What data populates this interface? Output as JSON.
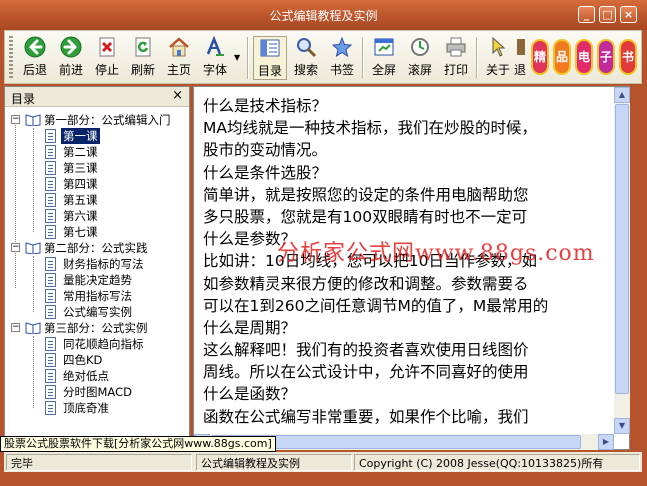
{
  "window": {
    "title": "公式编辑教程及实例",
    "controls": {
      "minimize": "_",
      "maximize": "□",
      "close": "×"
    }
  },
  "toolbar": {
    "buttons": [
      {
        "id": "back",
        "label": "后退",
        "icon": "back-arrow-icon"
      },
      {
        "id": "forward",
        "label": "前进",
        "icon": "forward-arrow-icon"
      },
      {
        "id": "stop",
        "label": "停止",
        "icon": "stop-icon"
      },
      {
        "id": "refresh",
        "label": "刷新",
        "icon": "refresh-icon"
      },
      {
        "id": "home",
        "label": "主页",
        "icon": "home-icon"
      },
      {
        "id": "font",
        "label": "字体",
        "icon": "font-icon"
      },
      {
        "id": "toc",
        "label": "目录",
        "icon": "toc-icon"
      },
      {
        "id": "search",
        "label": "搜索",
        "icon": "search-icon"
      },
      {
        "id": "bookmark",
        "label": "书签",
        "icon": "bookmark-star-icon"
      },
      {
        "id": "fullscreen",
        "label": "全屏",
        "icon": "fullscreen-icon"
      },
      {
        "id": "autoscroll",
        "label": "滚屏",
        "icon": "autoscroll-icon"
      },
      {
        "id": "print",
        "label": "打印",
        "icon": "print-icon"
      },
      {
        "id": "about",
        "label": "关于",
        "icon": "about-pointer-icon"
      },
      {
        "id": "exit",
        "label": "退",
        "icon": "exit-icon"
      }
    ],
    "decor": [
      "精",
      "品",
      "电",
      "子",
      "书"
    ]
  },
  "toc_panel": {
    "header": "目录",
    "close": "×",
    "tree": [
      {
        "label": "第一部分：公式编辑入门",
        "children": [
          "第一课",
          "第二课",
          "第三课",
          "第四课",
          "第五课",
          "第六课",
          "第七课"
        ]
      },
      {
        "label": "第二部分：公式实践",
        "children": [
          "财务指标的写法",
          "量能决定趋势",
          "常用指标写法",
          "公式编写实例"
        ]
      },
      {
        "label": "第三部分：公式实例",
        "children": [
          "同花顺趋向指标",
          "四色KD",
          "绝对低点",
          "分时图MACD",
          "顶底奇准"
        ]
      }
    ],
    "selected": "第一课"
  },
  "content": {
    "lines": [
      "什么是技术指标？",
      "MA均线就是一种技术指标，我们在炒股的时候，",
      "股市的变动情况。",
      "什么是条件选股？",
      "简单讲，就是按照您的设定的条件用电脑帮助您",
      "多只股票，您就是有100双眼睛有时也不一定可",
      "什么是参数？",
      "比如讲：10日均线，您可以把10日当作参数，如",
      "如参数精灵来很方便的修改和调整。参数需要る",
      "可以在1到260之间任意调节M的值了，M最常用的",
      "什么是周期？",
      "这么解释吧！我们有的投资者喜欢使用日线图价",
      "周线。所以在公式设计中，允许不同喜好的使用",
      "什么是函数？",
      "函数在公式编写非常重要，如果作个比喻，我们"
    ],
    "watermark": "分析家公式网www.88gs.com"
  },
  "ad_bar": "股票公式股票软件下载[分析家公式网www.88gs.com]",
  "statusbar": {
    "status": "完毕",
    "doc_title": "公式编辑教程及实例",
    "copyright": "Copyright (C) 2008 Jesse(QQ:10133825)所有"
  },
  "colors": {
    "frame": "#b5542c",
    "toolbar_bg": "#ece9d8",
    "selection": "#0a246a",
    "watermark": "#e02020"
  }
}
